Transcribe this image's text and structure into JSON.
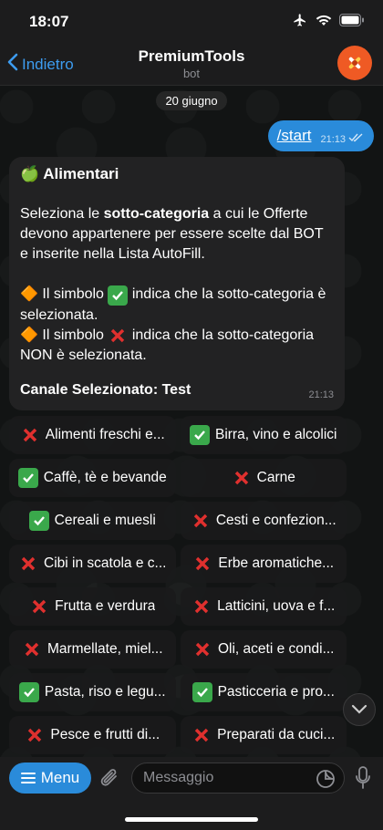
{
  "status_bar": {
    "time": "18:07"
  },
  "header": {
    "back_label": "Indietro",
    "title": "PremiumTools",
    "subtitle": "bot"
  },
  "date_pill": "20 giugno",
  "outgoing": {
    "text": "/start",
    "time": "21:13"
  },
  "incoming": {
    "title": "🍏 Alimentari",
    "intro_prefix": "Seleziona le ",
    "intro_bold": "sotto-categoria",
    "intro_suffix": " a cui le Offerte devono appartenere per essere scelte dal BOT e inserite nella Lista AutoFill.",
    "line1_prefix": "🔶 Il simbolo ",
    "line1_suffix": " indica che la sotto-categoria è selezionata.",
    "line2_prefix": "🔶 Il simbolo ",
    "line2_suffix": " indica che la sotto-categoria NON è selezionata.",
    "canale": "Canale Selezionato: Test",
    "time": "21:13"
  },
  "keyboard": [
    [
      {
        "label": "Alimenti freschi e...",
        "selected": false
      },
      {
        "label": "Birra, vino e alcolici",
        "selected": true
      }
    ],
    [
      {
        "label": "Caffè, tè e bevande",
        "selected": true
      },
      {
        "label": "Carne",
        "selected": false
      }
    ],
    [
      {
        "label": "Cereali e muesli",
        "selected": true
      },
      {
        "label": "Cesti e confezion...",
        "selected": false
      }
    ],
    [
      {
        "label": "Cibi in scatola e c...",
        "selected": false
      },
      {
        "label": "Erbe aromatiche...",
        "selected": false
      }
    ],
    [
      {
        "label": "Frutta e verdura",
        "selected": false
      },
      {
        "label": "Latticini, uova e f...",
        "selected": false
      }
    ],
    [
      {
        "label": "Marmellate, miel...",
        "selected": false
      },
      {
        "label": "Oli, aceti e condi...",
        "selected": false
      }
    ],
    [
      {
        "label": "Pasta, riso e legu...",
        "selected": true
      },
      {
        "label": "Pasticceria e pro...",
        "selected": true
      }
    ],
    [
      {
        "label": "Pesce e frutti di...",
        "selected": false
      },
      {
        "label": "Preparati da cuci...",
        "selected": false
      }
    ]
  ],
  "bottom": {
    "menu_label": "Menu",
    "input_placeholder": "Messaggio"
  },
  "colors": {
    "accent": "#2a8bda",
    "check": "#3aa84b",
    "cross": "#e0302e",
    "avatar": "#ef5a24"
  }
}
